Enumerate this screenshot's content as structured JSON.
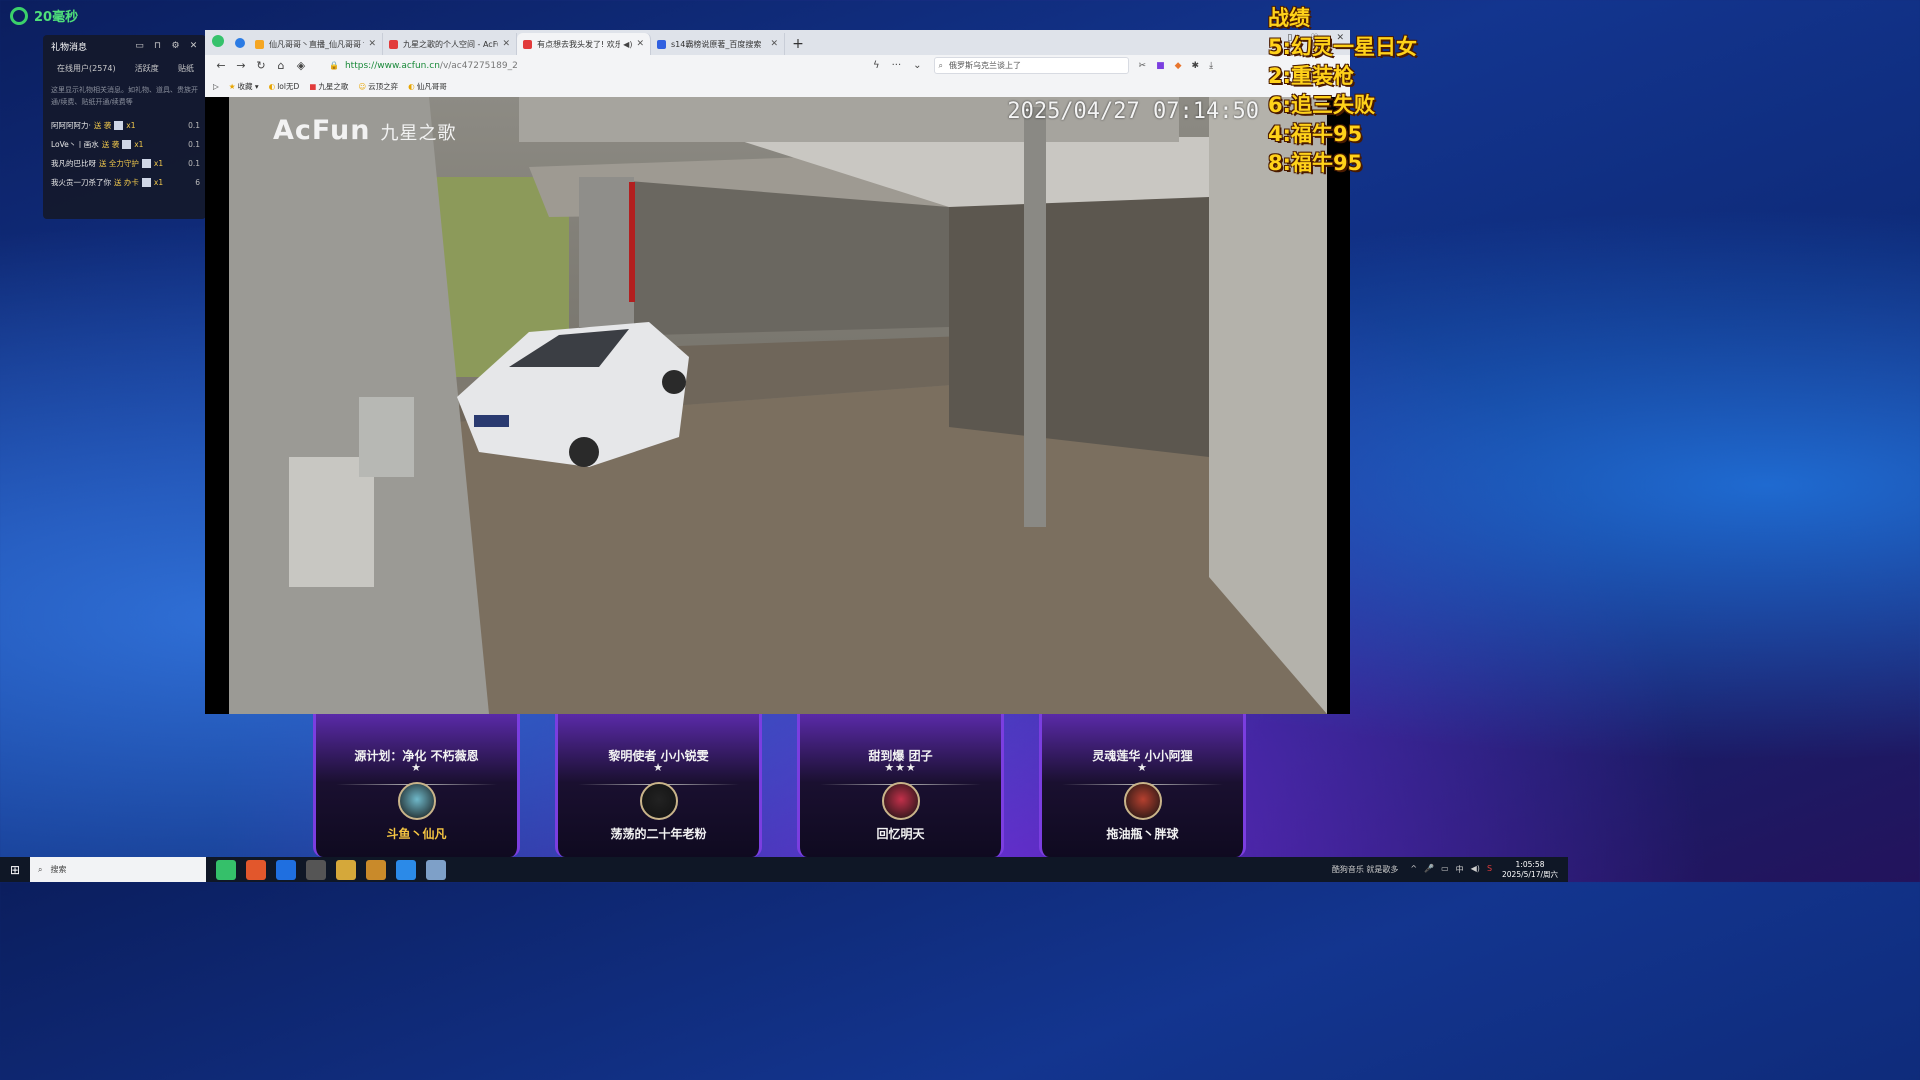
{
  "ping": {
    "text": "20毫秒"
  },
  "gift_panel": {
    "title": "礼物消息",
    "tabs": [
      "在线用户(2574)",
      "活跃度",
      "贴纸"
    ],
    "note": "这里显示礼物相关消息。如礼物、道具、贵族开通/续费、贴纸开通/续费等",
    "rows": [
      {
        "user": "阿阿阿阿力·",
        "action": "送 袭",
        "count": "x1",
        "value": "0.1"
      },
      {
        "user": "LoVe丶丨画水",
        "action": "送 袭",
        "count": "x1",
        "value": "0.1"
      },
      {
        "user": "我凡的巴比呀",
        "action": "送 全力守护",
        "count": "x1",
        "value": "0.1"
      },
      {
        "user": "我火贡一刀杀了你",
        "action": "送 办卡",
        "count": "x1",
        "value": "6"
      }
    ]
  },
  "browser": {
    "tabs": [
      {
        "title": "仙凡哥哥丶直播_仙凡哥哥丶直",
        "color": "#f5a623",
        "active": false,
        "speaker": false
      },
      {
        "title": "九星之歌的个人空间 - AcFun弹",
        "color": "#e23b3b",
        "active": false,
        "speaker": false
      },
      {
        "title": "有点想去我头发了! 欢乐丶",
        "color": "#e23b3b",
        "active": true,
        "speaker": true
      },
      {
        "title": "s14霸榜说原著_百度搜索",
        "color": "#3060e0",
        "active": false,
        "speaker": false
      }
    ],
    "url_host": "https://www.acfun.cn",
    "url_path": "/v/ac47275189_2",
    "search_text": "俄罗斯乌克兰谈上了",
    "bookmarks": [
      "收藏",
      "lol无D",
      "九星之歌",
      "云顶之弈",
      "仙凡哥哥"
    ]
  },
  "video": {
    "logo": "AcFun",
    "logo_sub": "九星之歌",
    "timestamp": "2025/04/27  07:14:50"
  },
  "scoreboard": {
    "title": "战绩",
    "lines": [
      "5:幻灵一星日女",
      "2:重装枪",
      "6:追三失败",
      "4:福牛95",
      "8:福牛95"
    ]
  },
  "cards": [
    {
      "name": "源计划：净化 不朽薇恩",
      "stars": "★",
      "player": "斗鱼丶仙凡",
      "player_color": "#f5c542",
      "badge_color": "#6fb8c9"
    },
    {
      "name": "黎明使者 小小锐雯",
      "stars": "★",
      "player": "荡荡的二十年老粉",
      "player_color": "#f2f2f2",
      "badge_color": "#222222"
    },
    {
      "name": "甜到爆 团子",
      "stars": "★★★",
      "player": "回忆明天",
      "player_color": "#f2f2f2",
      "badge_color": "#c2304a"
    },
    {
      "name": "灵魂莲华 小小阿狸",
      "stars": "★",
      "player": "拖油瓶丶胖球",
      "player_color": "#f2f2f2",
      "badge_color": "#b5402f"
    }
  ],
  "taskbar": {
    "search_placeholder": "搜索",
    "media_text": "酷狗音乐 就是歌多",
    "tray": [
      "^",
      "中",
      "S"
    ],
    "time": "1:05:58",
    "date": "2025/5/17/周六"
  }
}
